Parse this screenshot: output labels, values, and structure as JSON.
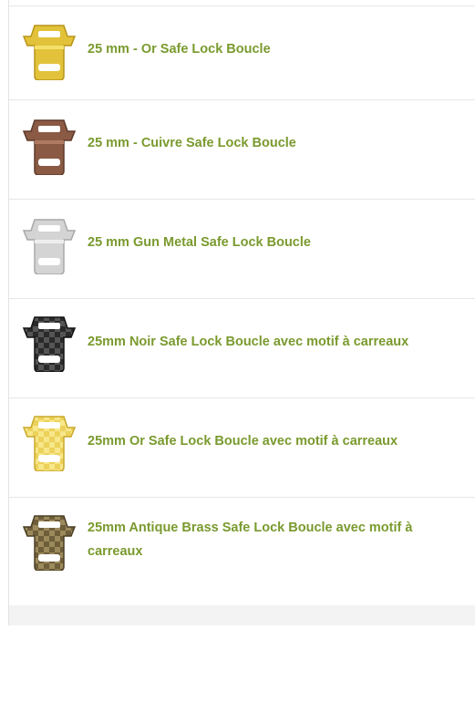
{
  "products": [
    {
      "title": "25 mm - Or Safe Lock Boucle",
      "finish": "gold",
      "colors": {
        "main": "#e2c23a",
        "dark": "#b8941a",
        "light": "#f4e06a"
      }
    },
    {
      "title": "25 mm - Cuivre Safe Lock Boucle",
      "finish": "copper",
      "colors": {
        "main": "#8a5a44",
        "dark": "#5e3a2a",
        "light": "#b07a60"
      }
    },
    {
      "title": "25 mm Gun Metal Safe Lock Boucle",
      "finish": "gun-metal",
      "colors": {
        "main": "#d4d4d4",
        "dark": "#a8a8a8",
        "light": "#eeeeee"
      }
    },
    {
      "title": "25mm Noir Safe Lock Boucle avec motif à carreaux",
      "finish": "black-checker",
      "colors": {
        "main": "#2a2a2a",
        "dark": "#111111",
        "light": "#555555"
      }
    },
    {
      "title": "25mm Or Safe Lock Boucle avec motif à carreaux",
      "finish": "gold-checker",
      "colors": {
        "main": "#ecd15a",
        "dark": "#c9a82a",
        "light": "#f7e78a"
      }
    },
    {
      "title": "25mm Antique Brass Safe Lock Boucle avec motif à carreaux",
      "finish": "antique-brass-checker",
      "colors": {
        "main": "#6e5e3a",
        "dark": "#4a3e24",
        "light": "#9c8a5c"
      }
    }
  ],
  "accent_color": "#7a9a2e"
}
